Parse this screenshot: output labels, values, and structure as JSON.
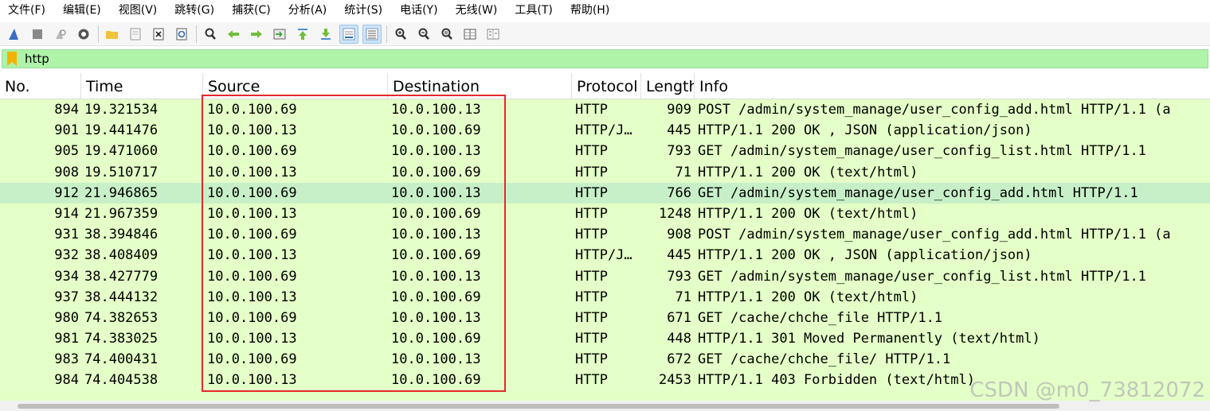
{
  "menubar": {
    "items": [
      "文件(F)",
      "编辑(E)",
      "视图(V)",
      "跳转(G)",
      "捕获(C)",
      "分析(A)",
      "统计(S)",
      "电话(Y)",
      "无线(W)",
      "工具(T)",
      "帮助(H)"
    ]
  },
  "toolbar": {
    "icons": [
      "shark-fin-icon",
      "stop-icon",
      "restart-icon",
      "options-gear-icon",
      "open-folder-icon",
      "file-icon",
      "close-file-icon",
      "reload-icon",
      "find-icon",
      "back-arrow-icon",
      "forward-arrow-icon",
      "goto-packet-icon",
      "first-packet-icon",
      "last-packet-icon",
      "autoscroll-icon",
      "colorize-icon",
      "zoom-in-icon",
      "zoom-out-icon",
      "zoom-normal-icon",
      "resize-columns-icon",
      "expand-icon"
    ]
  },
  "filter": {
    "value": "http",
    "bg_color": "#aff3a9"
  },
  "columns": {
    "no": "No.",
    "time": "Time",
    "source": "Source",
    "destination": "Destination",
    "protocol": "Protocol",
    "length": "Length",
    "info": "Info"
  },
  "rows": [
    {
      "no": "894",
      "time": "19.321534",
      "src": "10.0.100.69",
      "dst": "10.0.100.13",
      "proto": "HTTP",
      "len": "909",
      "info": "POST /admin/system_manage/user_config_add.html HTTP/1.1  (a"
    },
    {
      "no": "901",
      "time": "19.441476",
      "src": "10.0.100.13",
      "dst": "10.0.100.69",
      "proto": "HTTP/J…",
      "len": "445",
      "info": "HTTP/1.1 200 OK , JSON (application/json)"
    },
    {
      "no": "905",
      "time": "19.471060",
      "src": "10.0.100.69",
      "dst": "10.0.100.13",
      "proto": "HTTP",
      "len": "793",
      "info": "GET /admin/system_manage/user_config_list.html HTTP/1.1"
    },
    {
      "no": "908",
      "time": "19.510717",
      "src": "10.0.100.13",
      "dst": "10.0.100.69",
      "proto": "HTTP",
      "len": "71",
      "info": "HTTP/1.1 200 OK  (text/html)"
    },
    {
      "no": "912",
      "time": "21.946865",
      "src": "10.0.100.69",
      "dst": "10.0.100.13",
      "proto": "HTTP",
      "len": "766",
      "info": "GET /admin/system_manage/user_config_add.html HTTP/1.1",
      "highlight": true
    },
    {
      "no": "914",
      "time": "21.967359",
      "src": "10.0.100.13",
      "dst": "10.0.100.69",
      "proto": "HTTP",
      "len": "1248",
      "info": "HTTP/1.1 200 OK  (text/html)"
    },
    {
      "no": "931",
      "time": "38.394846",
      "src": "10.0.100.69",
      "dst": "10.0.100.13",
      "proto": "HTTP",
      "len": "908",
      "info": "POST /admin/system_manage/user_config_add.html HTTP/1.1  (a"
    },
    {
      "no": "932",
      "time": "38.408409",
      "src": "10.0.100.13",
      "dst": "10.0.100.69",
      "proto": "HTTP/J…",
      "len": "445",
      "info": "HTTP/1.1 200 OK , JSON (application/json)"
    },
    {
      "no": "934",
      "time": "38.427779",
      "src": "10.0.100.69",
      "dst": "10.0.100.13",
      "proto": "HTTP",
      "len": "793",
      "info": "GET /admin/system_manage/user_config_list.html HTTP/1.1"
    },
    {
      "no": "937",
      "time": "38.444132",
      "src": "10.0.100.13",
      "dst": "10.0.100.69",
      "proto": "HTTP",
      "len": "71",
      "info": "HTTP/1.1 200 OK  (text/html)"
    },
    {
      "no": "980",
      "time": "74.382653",
      "src": "10.0.100.69",
      "dst": "10.0.100.13",
      "proto": "HTTP",
      "len": "671",
      "info": "GET /cache/chche_file HTTP/1.1"
    },
    {
      "no": "981",
      "time": "74.383025",
      "src": "10.0.100.13",
      "dst": "10.0.100.69",
      "proto": "HTTP",
      "len": "448",
      "info": "HTTP/1.1 301 Moved Permanently  (text/html)"
    },
    {
      "no": "983",
      "time": "74.400431",
      "src": "10.0.100.69",
      "dst": "10.0.100.13",
      "proto": "HTTP",
      "len": "672",
      "info": "GET /cache/chche_file/ HTTP/1.1"
    },
    {
      "no": "984",
      "time": "74.404538",
      "src": "10.0.100.13",
      "dst": "10.0.100.69",
      "proto": "HTTP",
      "len": "2453",
      "info": "HTTP/1.1 403 Forbidden  (text/html)"
    }
  ],
  "colors": {
    "row_bg": "#e4ffc7",
    "row_selected": "#c8f0c8",
    "annotation": "#e5292b"
  },
  "watermark": "CSDN @m0_73812072"
}
